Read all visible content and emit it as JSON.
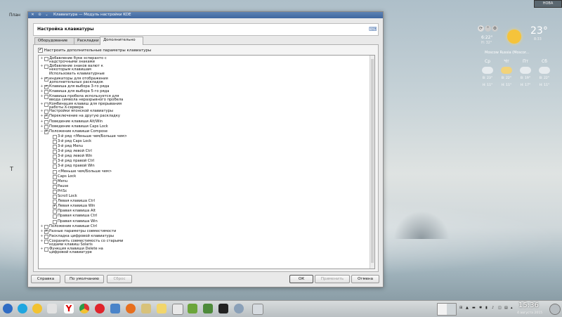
{
  "desktop": {
    "label_top": "План",
    "cursor_glyph": "T",
    "top_right_button": "НОВА"
  },
  "window": {
    "title": "Клавиатура — Модуль настройки KDE",
    "header_title": "Настройка клавиатуры",
    "tabs": [
      "Оборудование",
      "Раскладки",
      "Дополнительно"
    ],
    "active_tab": 2,
    "top_checkbox_label": "Настроить дополнительные параметры клавиатуры",
    "tree": [
      {
        "label": "Добавление букв эсперанто с",
        "label2": "надстрочными знаками",
        "expand": "+",
        "check": "",
        "level": 0
      },
      {
        "label": "Добавление знаков валют к",
        "label2": "некоторым клавишам",
        "expand": "+",
        "check": "",
        "level": 0
      },
      {
        "label": "Использовать клавиатурные",
        "label2": "",
        "expand": "",
        "check": "",
        "level": 0,
        "no_box": true
      },
      {
        "label": "индикаторы для отображения",
        "label2": "дополнительных раскладок",
        "expand": "+",
        "check": "✔",
        "level": 0
      },
      {
        "label": "Клавиша для выбора 3-го ряда",
        "label2": "",
        "expand": "+",
        "check": "✔",
        "level": 0
      },
      {
        "label": "Клавиша для выбора 5-го ряда",
        "label2": "",
        "expand": "+",
        "check": "",
        "level": 0
      },
      {
        "label": "Клавиша пробела используется для",
        "label2": "ввода символа неразрывного пробела",
        "expand": "+",
        "check": "",
        "level": 0
      },
      {
        "label": "Комбинация клавиш для прерывания",
        "label2": "работы X-сервера",
        "expand": "+",
        "check": "",
        "level": 0
      },
      {
        "label": "Настройки японской клавиатуры",
        "label2": "",
        "expand": "+",
        "check": "",
        "level": 0
      },
      {
        "label": "Переключение на другую раскладку",
        "label2": "",
        "expand": "+",
        "check": "✔",
        "level": 0
      },
      {
        "label": "Поведение клавиши Alt/Win",
        "label2": "",
        "expand": "+",
        "check": "",
        "level": 0
      },
      {
        "label": "Поведение клавиши Caps Lock",
        "label2": "",
        "expand": "+",
        "check": "",
        "level": 0
      },
      {
        "label": "Положение клавиши Compose",
        "label2": "",
        "expand": "−",
        "check": "✔",
        "level": 0
      },
      {
        "label": "3-й ряд <Меньше чем/Больше чем>",
        "label2": "",
        "expand": "",
        "check": "",
        "level": 1
      },
      {
        "label": "3-й ряд Caps Lock",
        "label2": "",
        "expand": "",
        "check": "",
        "level": 1
      },
      {
        "label": "3-й ряд Menu",
        "label2": "",
        "expand": "",
        "check": "",
        "level": 1
      },
      {
        "label": "3-й ряд левой Ctrl",
        "label2": "",
        "expand": "",
        "check": "",
        "level": 1
      },
      {
        "label": "3-й ряд левой Win",
        "label2": "",
        "expand": "",
        "check": "",
        "level": 1
      },
      {
        "label": "3-й ряд правой Ctrl",
        "label2": "",
        "expand": "",
        "check": "",
        "level": 1
      },
      {
        "label": "3-й ряд правой Win",
        "label2": "",
        "expand": "",
        "check": "",
        "level": 1
      },
      {
        "label": "<Меньше чем/Больше чем>",
        "label2": "",
        "expand": "",
        "check": "",
        "level": 1
      },
      {
        "label": "Caps Lock",
        "label2": "",
        "expand": "",
        "check": "",
        "level": 1
      },
      {
        "label": "Menu",
        "label2": "",
        "expand": "",
        "check": "",
        "level": 1
      },
      {
        "label": "Pause",
        "label2": "",
        "expand": "",
        "check": "",
        "level": 1
      },
      {
        "label": "PrtSc",
        "label2": "",
        "expand": "",
        "check": "",
        "level": 1
      },
      {
        "label": "Scroll Lock",
        "label2": "",
        "expand": "",
        "check": "",
        "level": 1
      },
      {
        "label": "Левая клавиша Ctrl",
        "label2": "",
        "expand": "",
        "check": "",
        "level": 1
      },
      {
        "label": "Левая клавиша Win",
        "label2": "",
        "expand": "",
        "check": "✔",
        "level": 1
      },
      {
        "label": "Правая клавиша Alt",
        "label2": "",
        "expand": "",
        "check": "",
        "level": 1
      },
      {
        "label": "Правая клавиша Ctrl",
        "label2": "",
        "expand": "",
        "check": "",
        "level": 1
      },
      {
        "label": "Правая клавиша Win",
        "label2": "",
        "expand": "",
        "check": "",
        "level": 1
      },
      {
        "label": "Положение клавиши Ctrl",
        "label2": "",
        "expand": "+",
        "check": "",
        "level": 0
      },
      {
        "label": "Разные параметры совместимости",
        "label2": "",
        "expand": "+",
        "check": "✔",
        "level": 0
      },
      {
        "label": "Раскладка цифровой клавиатуры",
        "label2": "",
        "expand": "+",
        "check": "",
        "level": 0
      },
      {
        "label": "Сохранить совместимость со старыми",
        "label2": "кодами клавиш Solaris",
        "expand": "+",
        "check": "",
        "level": 0
      },
      {
        "label": "Функция клавиши Delete на",
        "label2": "цифровой клавиатуре",
        "expand": "+",
        "check": "",
        "level": 0
      }
    ],
    "buttons": {
      "help": "Справка",
      "defaults": "По умолчанию",
      "reset": "Сброс",
      "ok": "ОК",
      "apply": "Применить",
      "cancel": "Отмена"
    }
  },
  "weather": {
    "now_temp_small": "6:22°",
    "now_small2": "H: 32°",
    "temp": "23°",
    "temp_small": "8:33",
    "location": "Moscow Russia (Moscor...",
    "days": [
      {
        "name": "Ср",
        "hi": "В: 23°",
        "lo": "Н: 11°"
      },
      {
        "name": "Чт",
        "hi": "В: 22°",
        "lo": "Н: 11°"
      },
      {
        "name": "Пт",
        "hi": "В: 19°",
        "lo": "Н: 17°"
      },
      {
        "name": "Сб",
        "hi": "В: 22°",
        "lo": "Н: 11°"
      }
    ]
  },
  "taskbar": {
    "clock": "15:36",
    "date": "4 августа 2015"
  }
}
